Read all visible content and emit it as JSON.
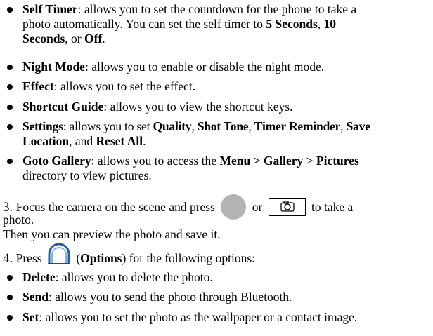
{
  "bullets_top": [
    {
      "title": "Self Timer",
      "lines": [
        ": allows you to set the countdown for the phone to take a",
        "photo automatically. You can set the self timer to ",
        "Seconds",
        ", or ",
        "Off",
        "."
      ],
      "opt1": "5 Seconds",
      "sep1": ", ",
      "opt2": "10"
    },
    {
      "title": "Night Mode",
      "text": ": allows you to enable or disable the night mode."
    },
    {
      "title": "Effect",
      "text": ": allows you to set the effect."
    },
    {
      "title": "Shortcut Guide",
      "text": ": allows you to view the shortcut keys."
    },
    {
      "title": "Settings",
      "text1": ": allows you to set ",
      "q": "Quality",
      "c1": ", ",
      "st": "Shot Tone",
      "c2": ", ",
      "tr": "Timer Reminder",
      "c3": ", ",
      "sv": "Save",
      "loc": "Location",
      "and": ", and ",
      "ra": "Reset All",
      "end": "."
    },
    {
      "title": "Goto Gallery",
      "text1": ": allows you to access the ",
      "path1": "Menu > Gallery",
      "sep": " > ",
      "path2": "Pictures",
      "line2": "directory to view pictures."
    }
  ],
  "step3": {
    "number": "3.",
    "text1": "Focus the camera on the scene and press",
    "or": "or",
    "text2": "to take a",
    "line2": "photo.",
    "line3": "Then you can preview the photo and save it."
  },
  "step4": {
    "number": "4.",
    "press": "Press",
    "options_open": "(",
    "options": "Options",
    "options_close": ") for the following options:"
  },
  "bullets_bottom": [
    {
      "title": "Delete",
      "text": ": allows you to delete the photo."
    },
    {
      "title": "Send",
      "text": ": allows you to send the photo through Bluetooth."
    },
    {
      "title": "Set",
      "text": ": allows you to set the photo as the wallpaper or a contact image."
    }
  ],
  "icons": {
    "circle_button": "round-key-icon",
    "camera_key": "camera-key-icon",
    "options_key": "options-softkey-icon"
  },
  "colors": {
    "circle_button": "#b3b3b3",
    "options_arc_outer": "#1f5fa8",
    "options_arc_inner": "#7fb3e6"
  }
}
